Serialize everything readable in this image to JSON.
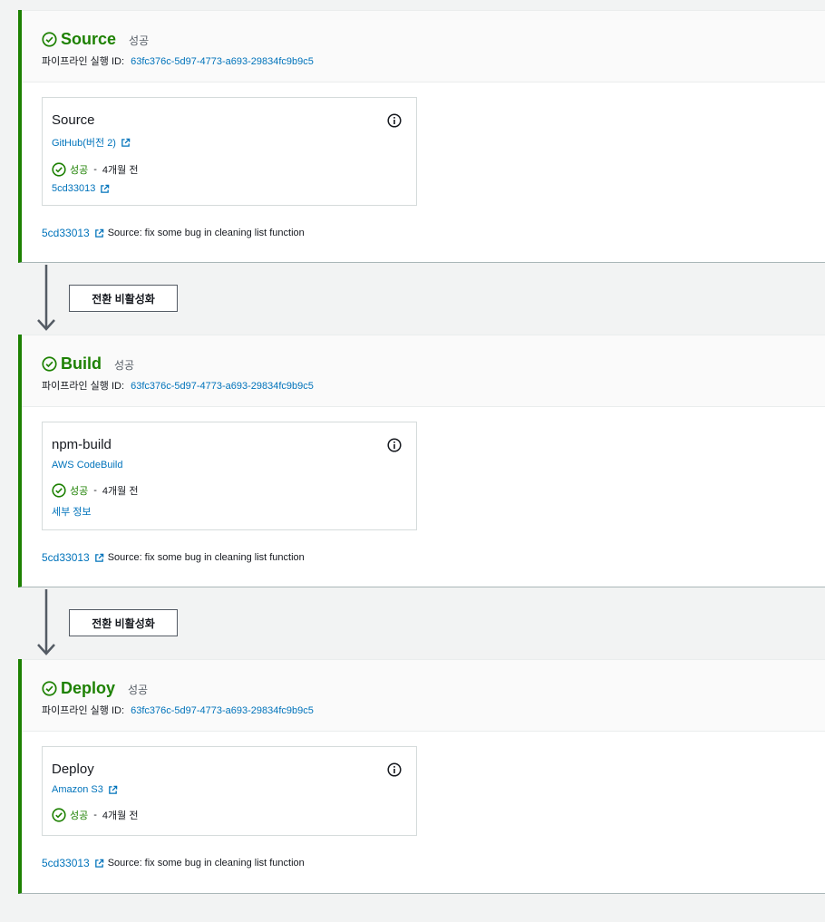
{
  "stages": [
    {
      "name": "Source",
      "status": "성공",
      "exec_label": "파이프라인 실행 ID:",
      "exec_id": "63fc376c-5d97-4773-a693-29834fc9b9c5",
      "action": {
        "name": "Source",
        "provider": "GitHub(버전 2)",
        "status": "성공",
        "separator": "-",
        "time": "4개월 전",
        "link": "5cd33013"
      },
      "commit_id": "5cd33013",
      "commit_msg": "Source: fix some bug in cleaning list function"
    },
    {
      "name": "Build",
      "status": "성공",
      "exec_label": "파이프라인 실행 ID:",
      "exec_id": "63fc376c-5d97-4773-a693-29834fc9b9c5",
      "action": {
        "name": "npm-build",
        "provider": "AWS CodeBuild",
        "status": "성공",
        "separator": "-",
        "time": "4개월 전",
        "link": "세부 정보"
      },
      "commit_id": "5cd33013",
      "commit_msg": "Source: fix some bug in cleaning list function"
    },
    {
      "name": "Deploy",
      "status": "성공",
      "exec_label": "파이프라인 실행 ID:",
      "exec_id": "63fc376c-5d97-4773-a693-29834fc9b9c5",
      "action": {
        "name": "Deploy",
        "provider": "Amazon S3",
        "status": "성공",
        "separator": "-",
        "time": "4개월 전"
      },
      "commit_id": "5cd33013",
      "commit_msg": "Source: fix some bug in cleaning list function"
    }
  ],
  "transitions": [
    {
      "button_label": "전환 비활성화"
    },
    {
      "button_label": "전환 비활성화"
    }
  ],
  "icons": {
    "success": "check-circle-icon",
    "info": "info-icon",
    "external": "external-link-icon"
  },
  "colors": {
    "success": "#1d8102",
    "link": "#0073bb",
    "stage_border": "#1d8102"
  }
}
